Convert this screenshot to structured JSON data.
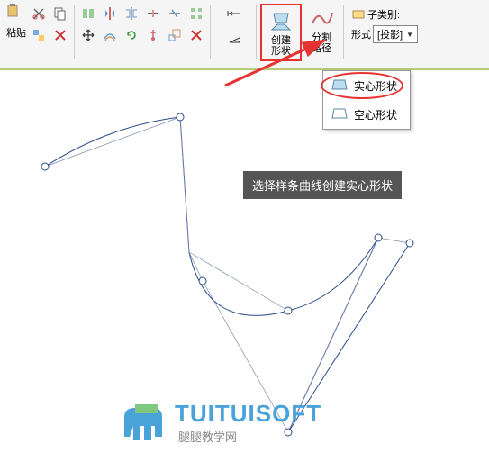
{
  "ribbon": {
    "paste_label": "粘贴",
    "create_shape_label": "创建\n形状",
    "split_path_label": "分割\n路径",
    "subcategory_label": "子类别:",
    "form_label": "形式"
  },
  "combo": {
    "value": "[投影]"
  },
  "dropdown": {
    "solid": "实心形状",
    "void": "空心形状"
  },
  "tooltip": "选择样条曲线创建实心形状",
  "watermark": {
    "brand": "TUITUISOFT",
    "sub": "腿腿教学网"
  },
  "colors": {
    "accent": "#4aa3d8",
    "highlight": "#e73232",
    "tooltip_bg": "#555"
  }
}
